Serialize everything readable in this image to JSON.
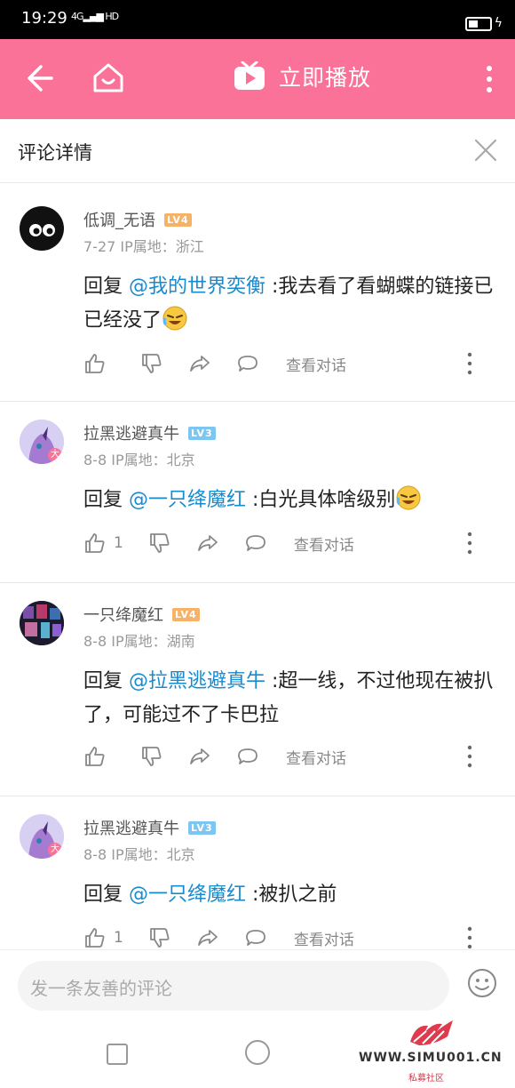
{
  "status_bar": {
    "time": "19:29",
    "network": "4G",
    "hd": "HD"
  },
  "app_bar": {
    "play_label": "立即播放"
  },
  "sheet": {
    "title": "评论详情"
  },
  "comments": [
    {
      "username": "低调_无语",
      "level": "LV4",
      "date_location": "7-27  IP属地：浙江",
      "reply_prefix": "回复 ",
      "mention": "@我的世界奕衡",
      "text": " :我去看了看蝴蝶的链接已已经没了",
      "emoji": "crying-laugh",
      "likes": "",
      "view_conversation": "查看对话"
    },
    {
      "username": "拉黑逃避真牛",
      "level": "LV3",
      "date_location": "8-8  IP属地：北京",
      "reply_prefix": "回复 ",
      "mention": "@一只绛魔红",
      "text": " :白光具体啥级别",
      "emoji": "crying-laugh",
      "likes": "1",
      "view_conversation": "查看对话"
    },
    {
      "username": "一只绛魔红",
      "level": "LV4",
      "date_location": "8-8  IP属地：湖南",
      "reply_prefix": "回复 ",
      "mention": "@拉黑逃避真牛",
      "text": " :超一线，不过他现在被扒了，可能过不了卡巴拉",
      "emoji": "",
      "likes": "",
      "view_conversation": "查看对话"
    },
    {
      "username": "拉黑逃避真牛",
      "level": "LV3",
      "date_location": "8-8  IP属地：北京",
      "reply_prefix": "回复 ",
      "mention": "@一只绛魔红",
      "text": " :被扒之前",
      "emoji": "",
      "likes": "1",
      "view_conversation": "查看对话"
    }
  ],
  "input": {
    "placeholder": "发一条友善的评论"
  },
  "watermark": {
    "url": "WWW.SIMU001.CN",
    "sub": "私募社区"
  },
  "colors": {
    "brand": "#fb7299",
    "mention": "#178bcf"
  }
}
